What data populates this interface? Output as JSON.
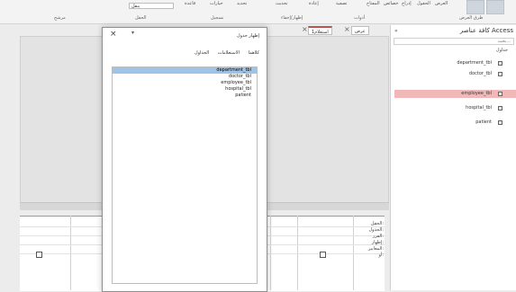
{
  "ribbon": {
    "items": [
      "العرض",
      "الحقول",
      "إدراج",
      "خصائص",
      "المفتاح",
      "تصفية",
      "إعادة",
      "تحديث",
      "تحديد",
      "خيارات",
      "قاعدة"
    ],
    "groups": [
      "طرق العرض",
      "أدوات",
      "إظهار/إخفاء",
      "تسجيل",
      "الحقل",
      "مرشح"
    ],
    "combo_value": "ينقل"
  },
  "tabs": [
    {
      "label": "عرض",
      "active": false
    },
    {
      "label": "استعلام1",
      "active": true
    }
  ],
  "dialog": {
    "title": "إظهار جدول",
    "tabs": [
      "الجداول",
      "الاستعلامات",
      "كلاهما"
    ],
    "items": [
      {
        "label": "department_tbl",
        "selected": true
      },
      {
        "label": "doctor_tbl",
        "selected": false
      },
      {
        "label": "employee_tbl",
        "selected": false
      },
      {
        "label": "hospital_tbl",
        "selected": false
      },
      {
        "label": "patient",
        "selected": false
      }
    ]
  },
  "grid": {
    "labels": [
      "الحقل:",
      "الجدول:",
      "الفرز:",
      "إظهار:",
      "المعايير:",
      "أو:"
    ]
  },
  "nav": {
    "title": "كافة عناصر Access",
    "search_placeholder": "بحث...",
    "section": "جداول",
    "items": [
      {
        "label": "department_tbl",
        "selected": false
      },
      {
        "label": "doctor_tbl",
        "selected": false
      },
      {
        "label": "employee_tbl",
        "selected": true
      },
      {
        "label": "hospital_tbl",
        "selected": false
      },
      {
        "label": "patient",
        "selected": false
      }
    ]
  }
}
